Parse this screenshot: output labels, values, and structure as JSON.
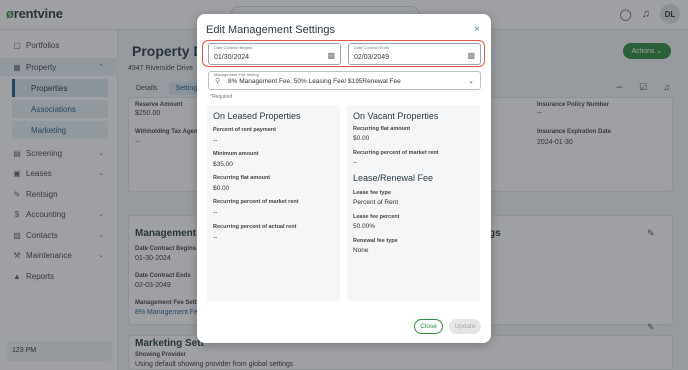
{
  "app": {
    "logo_text": "rentvine",
    "logo_mark": "ø",
    "user_initials": "DL"
  },
  "sidebar": {
    "items": [
      {
        "label": "Portfolios",
        "icon": "folder-icon"
      },
      {
        "label": "Property",
        "icon": "building-icon"
      },
      {
        "label": "Screening",
        "icon": "screening-icon"
      },
      {
        "label": "Leases",
        "icon": "lease-icon"
      },
      {
        "label": "Rentsign",
        "icon": "pen-icon"
      },
      {
        "label": "Accounting",
        "icon": "dollar-icon"
      },
      {
        "label": "Contacts",
        "icon": "contacts-icon"
      },
      {
        "label": "Maintenance",
        "icon": "wrench-icon"
      },
      {
        "label": "Reports",
        "icon": "chart-icon"
      }
    ],
    "sub_items": [
      "Properties",
      "Associations",
      "Marketing"
    ],
    "footer_text": "123 PM"
  },
  "page": {
    "title": "Property D",
    "address": "4947 Riverside Drive",
    "actions_label": "Actions",
    "tabs": [
      "Details",
      "Settings"
    ],
    "card1": {
      "label_a": "Reserve Amount",
      "value_a": "$250.00",
      "label_b": "Withholding Tax Agent",
      "value_b": "--",
      "label_c": "Insurance Policy Number",
      "value_c": "--",
      "label_d": "Insurance Expiration Date",
      "value_d": "2024-01-30"
    },
    "card2": {
      "title": "Management",
      "right_title": "gs",
      "begins_label": "Date Contract Begins",
      "begins_value": "01-30-2024",
      "ends_label": "Date Contract Ends",
      "ends_value": "02-03-2049",
      "fee_label": "Management Fee Setting",
      "fee_value": "8% Management Fee"
    },
    "card3": {
      "title": "Marketing Sett",
      "provider_label": "Showing Provider",
      "provider_value": "Using default showing provider from global settings"
    }
  },
  "modal": {
    "title": "Edit Management Settings",
    "date_begins_label": "Date Contract Begins",
    "date_begins_value": "01/30/2024",
    "date_ends_label": "Date Contract Ends",
    "date_ends_value": "02/03/2049",
    "fee_setting_label": "Management Fee Setting",
    "fee_setting_value": "8% Management Fee, 50% Leasing Fee/ $195Renewal Fee",
    "required_note": "*Required",
    "leased": {
      "title": "On Leased Properties",
      "fields": [
        {
          "label": "Percent of rent payment",
          "value": "--"
        },
        {
          "label": "Minimum amount",
          "value": "$35.00"
        },
        {
          "label": "Recurring flat amount",
          "value": "$0.00"
        },
        {
          "label": "Recurring percent of market rent",
          "value": "--"
        },
        {
          "label": "Recurring percent of actual rent",
          "value": "--"
        }
      ]
    },
    "vacant": {
      "title": "On Vacant Properties",
      "fields": [
        {
          "label": "Recurring flat amount",
          "value": "$0.00"
        },
        {
          "label": "Recurring percent of market rent",
          "value": "--"
        }
      ]
    },
    "lease_renewal": {
      "title": "Lease/Renewal Fee",
      "fields": [
        {
          "label": "Lease fee type",
          "value": "Percent of Rent"
        },
        {
          "label": "Lease fee percent",
          "value": "50.00%"
        },
        {
          "label": "Renewal fee type",
          "value": "None"
        }
      ]
    },
    "close_label": "Close",
    "update_label": "Update",
    "close_x": "×"
  }
}
